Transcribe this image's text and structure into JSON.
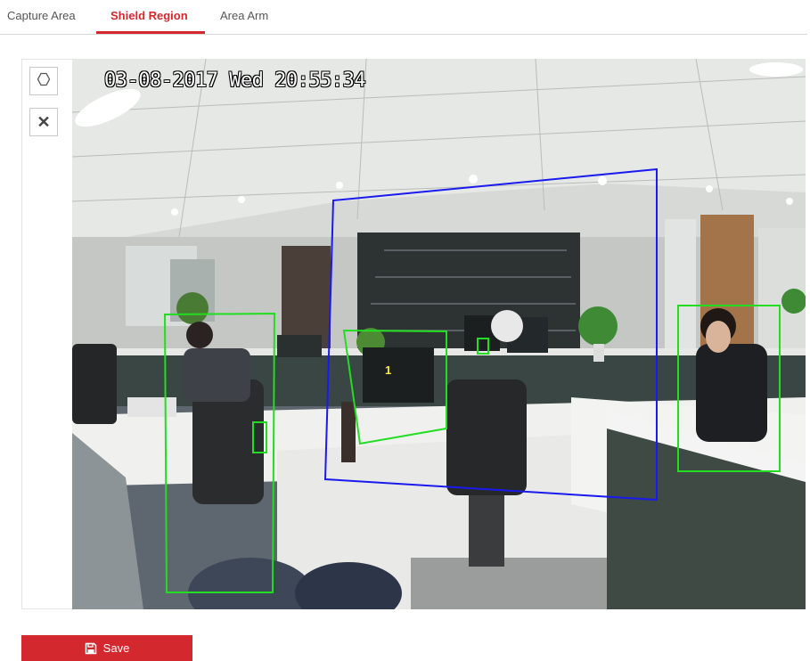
{
  "tabs": [
    {
      "label": "Capture Area",
      "active": false
    },
    {
      "label": "Shield Region",
      "active": true
    },
    {
      "label": "Area Arm",
      "active": false
    }
  ],
  "toolbar": {
    "draw_icon": "hexagon-icon",
    "clear_icon": "close-icon",
    "clear_glyph": "✕"
  },
  "video": {
    "osd_timestamp": "03-08-2017 Wed 20:55:34",
    "detection_region_label": "1"
  },
  "save_button": {
    "label": "Save",
    "icon": "floppy-disk-icon"
  },
  "colors": {
    "accent": "#d3282d",
    "detection_box": "#22dd22",
    "shield_region": "#1a1aee",
    "region_label": "#ffee33"
  }
}
